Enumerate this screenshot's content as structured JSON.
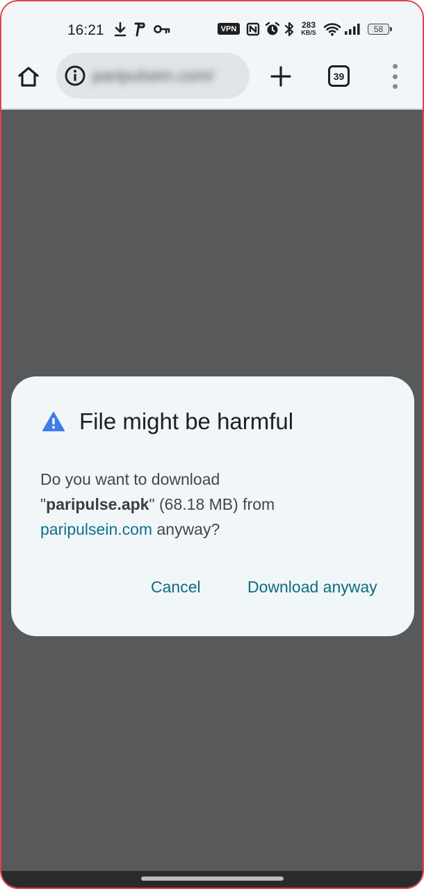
{
  "status_bar": {
    "time": "16:21",
    "vpn_label": "VPN",
    "net_speed_value": "283",
    "net_speed_unit": "KB/S",
    "battery_level": "58"
  },
  "toolbar": {
    "url": "paripulsein.com/",
    "tab_count": "39"
  },
  "dialog": {
    "title": "File might be harmful",
    "body_prefix": "Do you want to download",
    "quote_open": "\"",
    "filename": "paripulse.apk",
    "quote_close": "\"",
    "file_size": " (68.18 MB) from",
    "domain": "paripulsein.com",
    "body_suffix": " anyway?",
    "cancel_label": "Cancel",
    "confirm_label": "Download anyway"
  },
  "colors": {
    "accent": "#0e6c7d",
    "link": "#0e7289",
    "warning_icon": "#3f7ee8",
    "page_overlay": "#58595b",
    "dialog_bg": "#f1f6f9",
    "frame_border": "#e0424e"
  },
  "icons": {
    "status": [
      "download-icon",
      "p-app-icon",
      "key-icon",
      "vpn-icon",
      "nfc-icon",
      "alarm-icon",
      "bluetooth-icon",
      "wifi-icon",
      "signal-icon",
      "battery-icon"
    ],
    "toolbar": [
      "home-icon",
      "info-icon",
      "plus-icon",
      "tab-switcher-icon",
      "more-vert-icon"
    ],
    "dialog": [
      "warning-icon"
    ]
  }
}
